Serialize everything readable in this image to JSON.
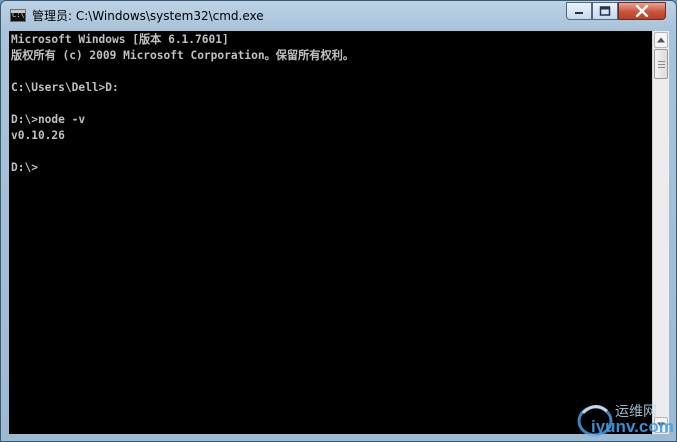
{
  "window": {
    "title": "管理员: C:\\Windows\\system32\\cmd.exe",
    "icon": "cmd-app-icon",
    "icon_text": "C:\\",
    "controls": [
      "minimize-icon",
      "maximize-icon",
      "close-icon"
    ]
  },
  "console": {
    "lines": [
      "Microsoft Windows [版本 6.1.7601]",
      "版权所有 (c) 2009 Microsoft Corporation。保留所有权利。",
      "",
      "C:\\Users\\Dell>D:",
      "",
      "D:\\>node -v",
      "v0.10.26",
      "",
      "D:\\>"
    ],
    "text_color": "#c0c0c0",
    "background": "#000000"
  },
  "watermark": {
    "cn_text": "运维网",
    "url_text": "iyunv.com"
  }
}
